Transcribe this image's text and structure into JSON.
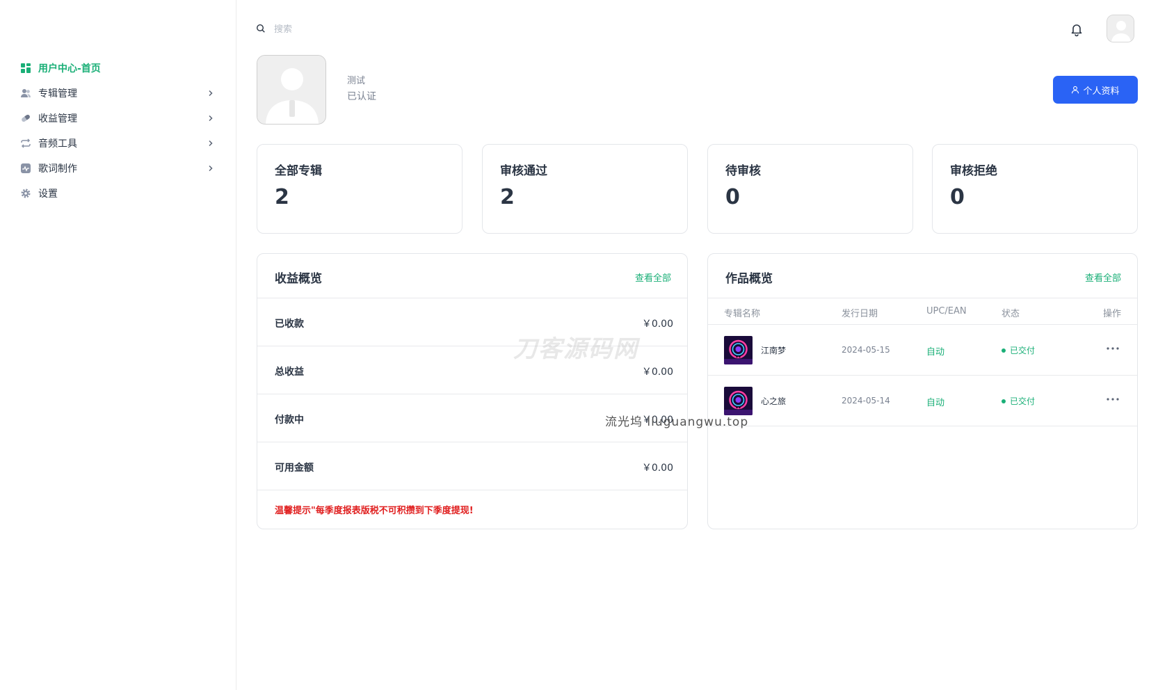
{
  "sidebar": {
    "items": [
      {
        "label": "用户中心-首页",
        "icon": "dashboard-icon"
      },
      {
        "label": "专辑管理",
        "icon": "users-icon"
      },
      {
        "label": "收益管理",
        "icon": "pill-icon"
      },
      {
        "label": "音频工具",
        "icon": "repeat-icon"
      },
      {
        "label": "歌词制作",
        "icon": "activity-icon"
      },
      {
        "label": "设置",
        "icon": "gear-icon"
      }
    ]
  },
  "search": {
    "placeholder": "搜索"
  },
  "profile": {
    "name": "测试",
    "status": "已认证",
    "button_label": "个人资料"
  },
  "stats": [
    {
      "label": "全部专辑",
      "value": "2"
    },
    {
      "label": "审核通过",
      "value": "2"
    },
    {
      "label": "待审核",
      "value": "0"
    },
    {
      "label": "审核拒绝",
      "value": "0"
    }
  ],
  "earnings": {
    "title": "收益概览",
    "view_all": "查看全部",
    "rows": [
      {
        "label": "已收款",
        "value": "￥0.00"
      },
      {
        "label": "总收益",
        "value": "￥0.00"
      },
      {
        "label": "付款中",
        "value": "￥0.00"
      },
      {
        "label": "可用金额",
        "value": "￥0.00"
      }
    ],
    "tip": "温馨提示\"每季度报表版税不可积攒到下季度提现!"
  },
  "works": {
    "title": "作品概览",
    "view_all": "查看全部",
    "columns": [
      "专辑名称",
      "发行日期",
      "UPC/EAN",
      "状态",
      "操作"
    ],
    "rows": [
      {
        "name": "江南梦",
        "date": "2024-05-15",
        "upc": "自动",
        "status": "已交付"
      },
      {
        "name": "心之旅",
        "date": "2024-05-14",
        "upc": "自动",
        "status": "已交付"
      }
    ]
  },
  "watermarks": {
    "text1": "刀客源码网",
    "text2": "流光坞 liuguangwu.top"
  },
  "colors": {
    "accent": "#1aaf77",
    "primary_button": "#2a63f5",
    "tip_red": "#e01f1f"
  }
}
